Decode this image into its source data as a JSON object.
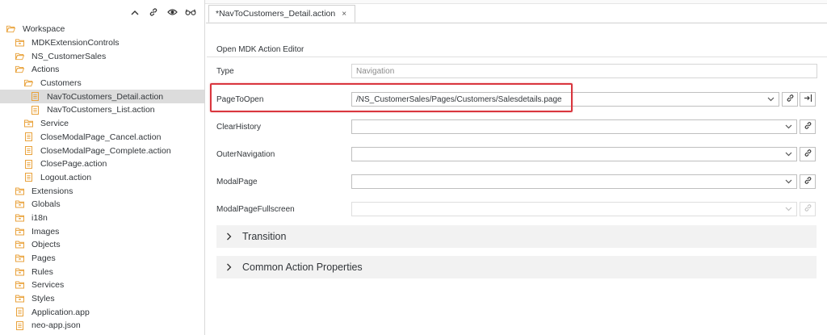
{
  "explorer": {
    "toolbar": [
      "collapse-all-icon",
      "link-icon",
      "eye-icon",
      "glasses-icon"
    ],
    "tree": [
      {
        "label": "Workspace",
        "icon": "folder-open",
        "level": 0
      },
      {
        "label": "MDKExtensionControls",
        "icon": "folder-closed",
        "level": 1
      },
      {
        "label": "NS_CustomerSales",
        "icon": "folder-open",
        "level": 1
      },
      {
        "label": "Actions",
        "icon": "folder-open",
        "level": 2
      },
      {
        "label": "Customers",
        "icon": "folder-open",
        "level": 3
      },
      {
        "label": "NavToCustomers_Detail.action",
        "icon": "file",
        "level": 4,
        "selected": true
      },
      {
        "label": "NavToCustomers_List.action",
        "icon": "file",
        "level": 4
      },
      {
        "label": "Service",
        "icon": "folder-closed",
        "level": 3
      },
      {
        "label": "CloseModalPage_Cancel.action",
        "icon": "file",
        "level": 3
      },
      {
        "label": "CloseModalPage_Complete.action",
        "icon": "file",
        "level": 3
      },
      {
        "label": "ClosePage.action",
        "icon": "file",
        "level": 3
      },
      {
        "label": "Logout.action",
        "icon": "file",
        "level": 3
      },
      {
        "label": "Extensions",
        "icon": "folder-closed",
        "level": 2
      },
      {
        "label": "Globals",
        "icon": "folder-closed",
        "level": 2
      },
      {
        "label": "i18n",
        "icon": "folder-closed",
        "level": 2
      },
      {
        "label": "Images",
        "icon": "folder-closed",
        "level": 2
      },
      {
        "label": "Objects",
        "icon": "folder-closed",
        "level": 2
      },
      {
        "label": "Pages",
        "icon": "folder-closed",
        "level": 2
      },
      {
        "label": "Rules",
        "icon": "folder-closed",
        "level": 2
      },
      {
        "label": "Services",
        "icon": "folder-closed",
        "level": 2
      },
      {
        "label": "Styles",
        "icon": "folder-closed",
        "level": 2
      },
      {
        "label": "Application.app",
        "icon": "file",
        "level": 2
      },
      {
        "label": "neo-app.json",
        "icon": "file",
        "level": 2
      }
    ]
  },
  "tab": {
    "label": "*NavToCustomers_Detail.action",
    "close": "×"
  },
  "editor": {
    "header": "Open MDK Action Editor",
    "type": {
      "label": "Type",
      "value": "Navigation"
    },
    "page_to_open": {
      "label": "PageToOpen",
      "value": "/NS_CustomerSales/Pages/Customers/Salesdetails.page"
    },
    "clear_history": {
      "label": "ClearHistory",
      "value": ""
    },
    "outer_navigation": {
      "label": "OuterNavigation",
      "value": ""
    },
    "modal_page": {
      "label": "ModalPage",
      "value": ""
    },
    "modal_page_fullscreen": {
      "label": "ModalPageFullscreen",
      "value": ""
    },
    "sections": [
      "Transition",
      "Common Action Properties"
    ]
  },
  "colors": {
    "folder": "#e9a23b",
    "highlight": "#d9363e",
    "selected_row": "#dcdcdc"
  }
}
